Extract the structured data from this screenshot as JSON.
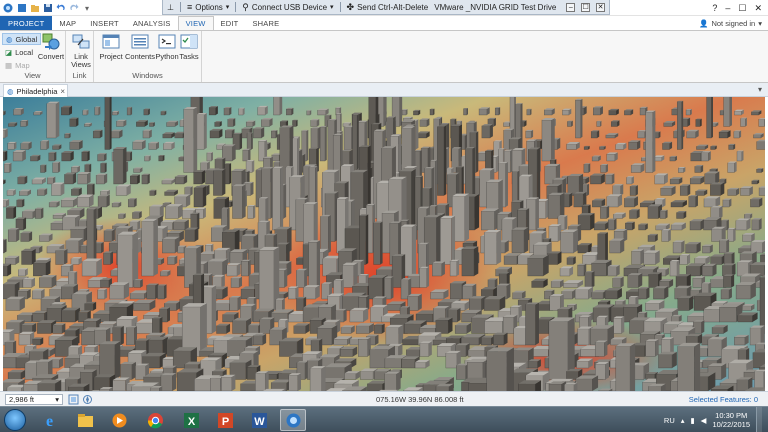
{
  "titlebar": {
    "help": "?",
    "min": "–",
    "max": "☐",
    "close": "✕"
  },
  "vmbar": {
    "options": "Options",
    "connect_usb": "Connect USB Device",
    "send_cad": "Send Ctrl-Alt-Delete",
    "title": "VMware _NVIDIA GRID Test Drive",
    "min": "–",
    "max": "☐",
    "close": "✕"
  },
  "tabs": [
    "PROJECT",
    "MAP",
    "INSERT",
    "ANALYSIS",
    "VIEW",
    "EDIT",
    "SHARE"
  ],
  "active_tab": "VIEW",
  "signin": "Not signed in",
  "ribbon": {
    "view_group": {
      "label": "View",
      "global": "Global",
      "local": "Local",
      "map": "Map",
      "convert": "Convert"
    },
    "link_group": {
      "label": "Link",
      "link_views_1": "Link",
      "link_views_2": "Views"
    },
    "windows_group": {
      "label": "Windows",
      "project": "Project",
      "contents": "Contents",
      "python": "Python",
      "tasks": "Tasks"
    }
  },
  "view_tab": {
    "name": "Philadelphia",
    "close": "×"
  },
  "statusbar": {
    "scale": "2,986 ft",
    "coords": "075.16W 39.96N  86.008 ft",
    "selected": "Selected Features: 0"
  },
  "taskbar": {
    "lang": "RU",
    "time": "10:30 PM",
    "date": "10/22/2015"
  },
  "colors": {
    "accent": "#1f65b3",
    "taskbar": "#4a5b69"
  }
}
